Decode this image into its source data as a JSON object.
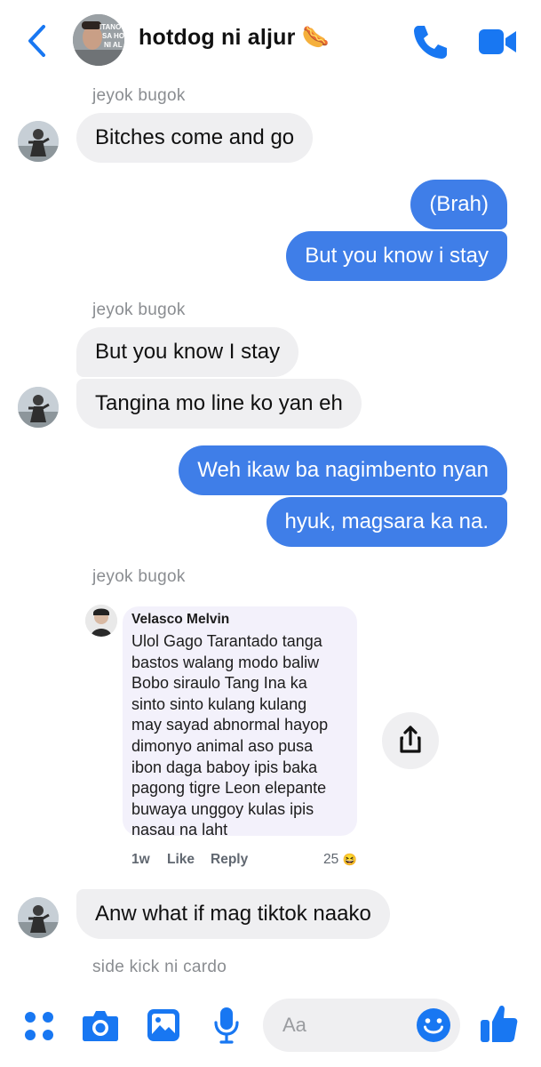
{
  "header": {
    "title": "hotdog ni aljur 🌭",
    "avatar_caption_lines": [
      "ITANO",
      "SA HO",
      "NI AL"
    ]
  },
  "messages": [
    {
      "sender": "jeyok bugok",
      "text": "Bitches come and go"
    },
    {
      "text": "(Brah)"
    },
    {
      "text": "But you know i stay"
    },
    {
      "sender": "jeyok bugok",
      "text": "But you know I stay"
    },
    {
      "text": "Tangina mo line ko yan eh"
    },
    {
      "text": "Weh ikaw ba nagimbento nyan"
    },
    {
      "text": "hyuk, magsara ka na."
    },
    {
      "sender": "jeyok bugok"
    },
    {
      "text": "Anw what if mag tiktok naako"
    },
    {
      "sender": "side kick ni cardo"
    }
  ],
  "shared_comment": {
    "author": "Velasco Melvin",
    "lines": [
      "Ulol Gago Tarantado tanga",
      "bastos walang modo baliw",
      "Bobo siraulo Tang Ina ka",
      "sinto sinto kulang kulang",
      "may sayad abnormal hayop",
      "dimonyo animal aso pusa",
      "ibon daga baboy ipis baka",
      "pagong tigre Leon elepante",
      "buwaya unggoy kulas ipis",
      "nasau na laht"
    ],
    "time": "1w",
    "like_label": "Like",
    "reply_label": "Reply",
    "reaction_count": "25",
    "reaction_emoji": "😆"
  },
  "composer": {
    "placeholder": "Aa"
  },
  "colors": {
    "accent": "#1877f2",
    "outgoing_bubble": "#3f7ee8",
    "incoming_bubble": "#efeff1"
  },
  "icons": [
    "back-chevron-icon",
    "phone-icon",
    "video-camera-icon",
    "share-icon",
    "apps-icon",
    "camera-icon",
    "gallery-icon",
    "microphone-icon",
    "emoji-icon",
    "thumbs-up-icon"
  ]
}
